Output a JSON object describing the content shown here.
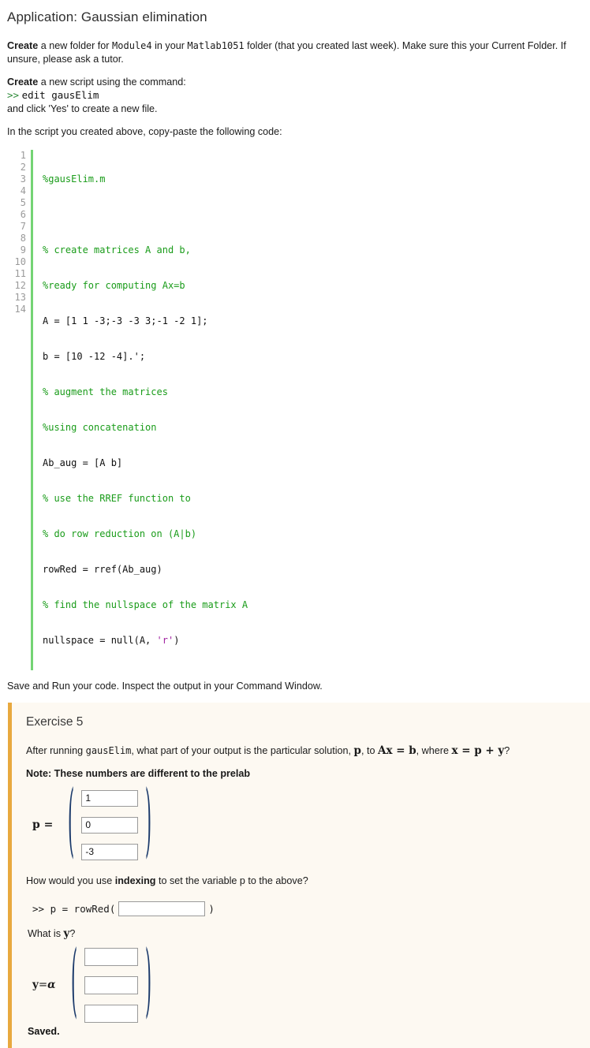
{
  "page": {
    "title": "Application: Gaussian elimination"
  },
  "instructions": {
    "p1_lead": "Create",
    "p1_a": " a new folder for ",
    "p1_mono1": "Module4",
    "p1_b": " in your ",
    "p1_mono2": "Matlab1051",
    "p1_c": " folder (that you created last week). Make sure this your Current Folder. If unsure, please ask a tutor.",
    "p2_lead": "Create",
    "p2_rest": " a new script using the command:",
    "p2_prompt": ">>",
    "p2_cmd": "edit gausElim",
    "p2_after": "and click 'Yes' to create a new file.",
    "p3": "In the script you created above, copy-paste the following code:",
    "p4": "Save and Run your code. Inspect the output in your Command Window."
  },
  "code": {
    "line_numbers": [
      "1",
      "2",
      "3",
      "4",
      "5",
      "6",
      "7",
      "8",
      "9",
      "10",
      "11",
      "12",
      "13",
      "14"
    ],
    "lines": [
      {
        "text": "%gausElim.m",
        "type": "comment"
      },
      {
        "text": "",
        "type": "blank"
      },
      {
        "text": "% create matrices A and b,",
        "type": "comment"
      },
      {
        "text": "%ready for computing Ax=b",
        "type": "comment"
      },
      {
        "text": "A = [1 1 -3;-3 -3 3;-1 -2 1];",
        "type": "code"
      },
      {
        "text": "b = [10 -12 -4].';",
        "type": "code"
      },
      {
        "text": "% augment the matrices",
        "type": "comment"
      },
      {
        "text": "%using concatenation",
        "type": "comment"
      },
      {
        "text": "Ab_aug = [A b]",
        "type": "code"
      },
      {
        "text": "% use the RREF function to",
        "type": "comment"
      },
      {
        "text": "% do row reduction on (A|b)",
        "type": "comment"
      },
      {
        "text": "rowRed = rref(Ab_aug)",
        "type": "code"
      },
      {
        "text": "% find the nullspace of the matrix A",
        "type": "comment"
      },
      {
        "text": "nullspace = null(A, 'r')",
        "type": "code-string"
      }
    ],
    "line14_pre": "nullspace = null(A, ",
    "line14_str": "'r'",
    "line14_post": ")"
  },
  "exercise": {
    "title": "Exercise 5",
    "question_a": "After running ",
    "question_mono": "gausElim",
    "question_b": ", what part of your output is the particular solution, ",
    "question_p": "p",
    "question_c": ", to ",
    "question_axb": "Ax = b",
    "question_d": ", where ",
    "question_xpy": "x = p + y",
    "question_e": "?",
    "note": "Note: These numbers are different to the prelab",
    "p_label": "p =",
    "p_values": [
      "1",
      "0",
      "-3"
    ],
    "indexing_question_a": "How would you use ",
    "indexing_question_bold": "indexing",
    "indexing_question_b": " to set the variable p to the above?",
    "indexing_prompt": ">> p = rowRed(",
    "indexing_value": "",
    "indexing_close": ")",
    "whatis_a": "What is ",
    "whatis_y": "y",
    "whatis_b": "?",
    "y_label_y": "y",
    "y_label_eq": "=",
    "y_label_alpha": "α",
    "y_values": [
      "",
      "",
      ""
    ],
    "saved": "Saved.",
    "accent_border": "#e8a93f",
    "background": "#fdf9f2"
  },
  "paren": {
    "left": "(",
    "right": ")"
  }
}
